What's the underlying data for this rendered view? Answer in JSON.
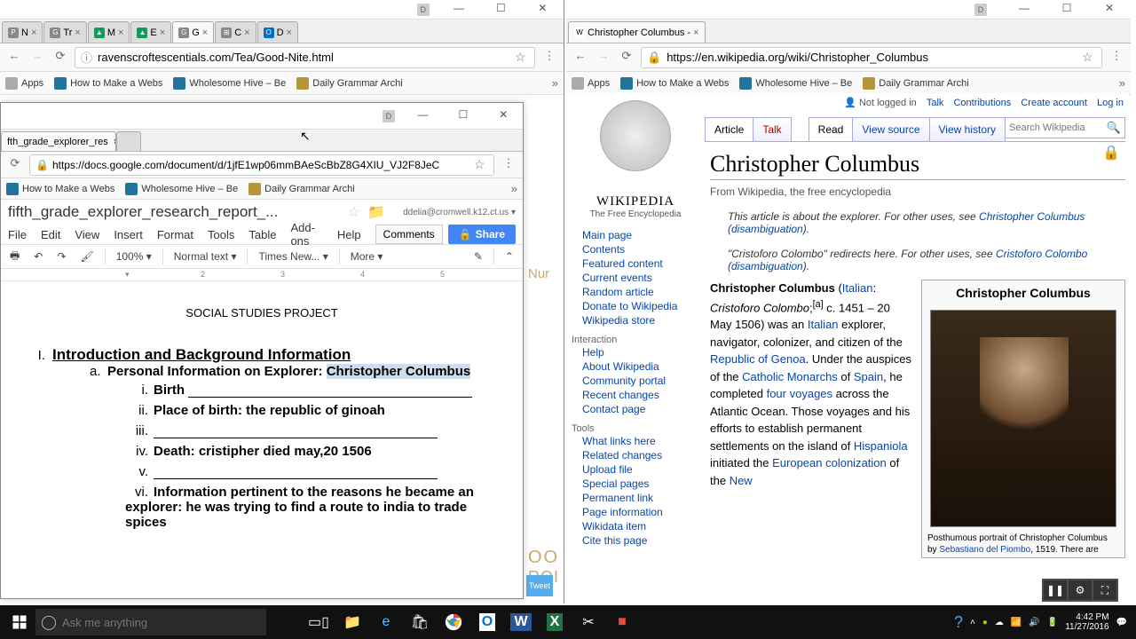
{
  "left_window": {
    "tabs": [
      {
        "fav": "P",
        "label": "N"
      },
      {
        "fav": "G",
        "label": "Tr"
      },
      {
        "fav": "▲",
        "label": "M"
      },
      {
        "fav": "▲",
        "label": "E"
      },
      {
        "fav": "G",
        "label": "G"
      },
      {
        "fav": "⊞",
        "label": "C"
      },
      {
        "fav": "O",
        "label": "D"
      }
    ],
    "url": "ravenscroftescentials.com/Tea/Good-Nite.html",
    "bookmarks": [
      "Apps",
      "How to Make a Webs",
      "Wholesome Hive – Be",
      "Daily Grammar Archi"
    ]
  },
  "docs_window": {
    "tab_label": "fth_grade_explorer_res",
    "url": "https://docs.google.com/document/d/1jfE1wp06mmBAeScBbZ8G4XIU_VJ2F8JeC",
    "bookmarks": [
      "How to Make a Webs",
      "Wholesome Hive – Be",
      "Daily Grammar Archi"
    ],
    "doc_title": "fifth_grade_explorer_research_report_...",
    "user_email": "ddelia@cromwell.k12.ct.us",
    "menus": [
      "File",
      "Edit",
      "View",
      "Insert",
      "Format",
      "Tools",
      "Table",
      "Add-ons",
      "Help"
    ],
    "comments_label": "Comments",
    "share_label": "Share",
    "toolbar": {
      "zoom": "100%",
      "style": "Normal text",
      "font": "Times New...",
      "more": "More"
    },
    "ruler_marks": [
      "2",
      "3",
      "4",
      "5"
    ],
    "doc": {
      "project": "SOCIAL STUDIES PROJECT",
      "section": "Introduction and Background Information",
      "item_a": "Personal Information on Explorer: ",
      "explorer": "Christopher Columbus",
      "i": "Birth",
      "ii": "Place of birth: the republic of  ginoah",
      "iv": "Death: cristipher died may,20 1506",
      "vi": "Information pertinent to the reasons he became an explorer: he was trying to find a route to india to trade spices"
    }
  },
  "right_window": {
    "tab_label": "Christopher Columbus -",
    "url": "https://en.wikipedia.org/wiki/Christopher_Columbus",
    "bookmarks": [
      "Apps",
      "How to Make a Webs",
      "Wholesome Hive – Be",
      "Daily Grammar Archi"
    ]
  },
  "wikipedia": {
    "logo_text": "WIKIPEDIA",
    "tagline": "The Free Encyclopedia",
    "nav_main": [
      "Main page",
      "Contents",
      "Featured content",
      "Current events",
      "Random article",
      "Donate to Wikipedia",
      "Wikipedia store"
    ],
    "nav_interaction_h": "Interaction",
    "nav_interaction": [
      "Help",
      "About Wikipedia",
      "Community portal",
      "Recent changes",
      "Contact page"
    ],
    "nav_tools_h": "Tools",
    "nav_tools": [
      "What links here",
      "Related changes",
      "Upload file",
      "Special pages",
      "Permanent link",
      "Page information",
      "Wikidata item",
      "Cite this page"
    ],
    "userbar": {
      "notlogged": "Not logged in",
      "links": [
        "Talk",
        "Contributions",
        "Create account",
        "Log in"
      ]
    },
    "tabs_left": [
      "Article",
      "Talk"
    ],
    "tabs_right": [
      "Read",
      "View source",
      "View history"
    ],
    "search_placeholder": "Search Wikipedia",
    "title": "Christopher Columbus",
    "subtitle": "From Wikipedia, the free encyclopedia",
    "hatnote1_pre": "This article is about the explorer. For other uses, see ",
    "hatnote1_link": "Christopher Columbus (disambiguation)",
    "hatnote2_pre": "\"Cristoforo Colombo\" redirects here. For other uses, see ",
    "hatnote2_link": "Cristoforo Colombo (disambiguation)",
    "infobox_title": "Christopher Columbus",
    "caption_1": "Posthumous portrait of Christopher Columbus",
    "caption_2a": "by ",
    "caption_2b": "Sebastiano del Piombo",
    "caption_2c": ", 1519. There are",
    "lead": {
      "bold": "Christopher Columbus",
      "p1a": " (",
      "italian": "Italian",
      "p1b": ": ",
      "it_name": "Cristoforo Colombo",
      "p1c": ";",
      "note": "[a]",
      "p1d": " c. 1451 – 20 May 1506) was an ",
      "italian2": "Italian",
      "p1e": " explorer, navigator, colonizer, and citizen of the ",
      "genoa": "Republic of Genoa",
      "p1f": ". Under the auspices of the ",
      "monarchs": "Catholic Monarchs",
      "p1g": " of ",
      "spain": "Spain",
      "p1h": ", he completed ",
      "voyages": "four voyages",
      "p1i": " across the Atlantic Ocean. Those voyages and his efforts to establish permanent settlements on the island of ",
      "hispaniola": "Hispaniola",
      "p1j": " initiated the ",
      "colonization": "European colonization",
      "p1k": " of the ",
      "newworld": "New"
    }
  },
  "bg_peek": {
    "nur": "Nur",
    "oo": "OO",
    "roi": "ROI"
  },
  "tweet": "Tweet",
  "taskbar": {
    "cortana": "Ask me anything",
    "time": "4:42 PM",
    "date": "11/27/2016"
  }
}
